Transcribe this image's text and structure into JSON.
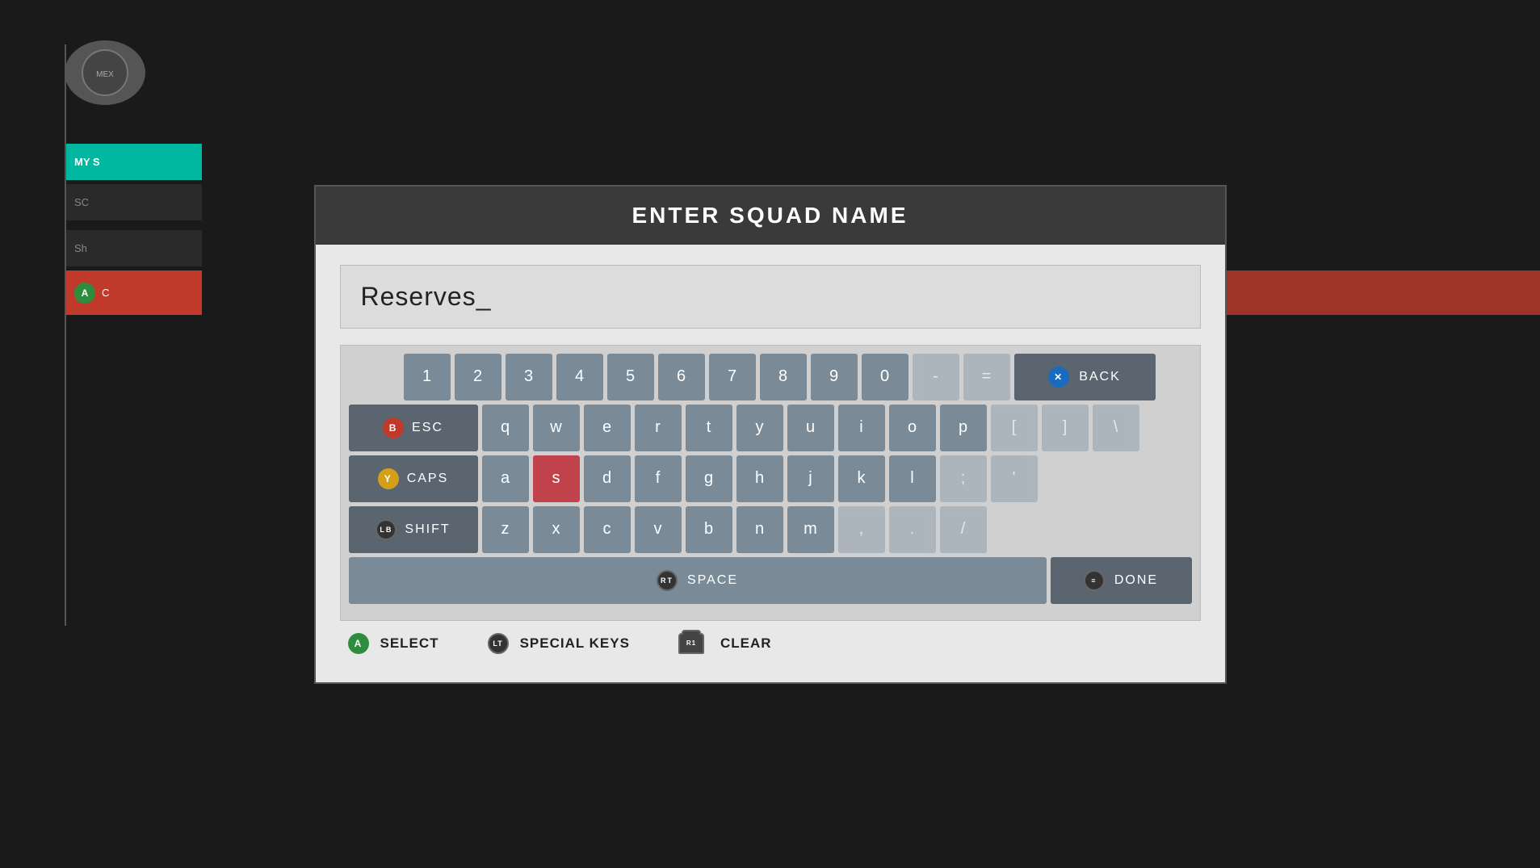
{
  "modal": {
    "title": "ENTER SQUAD NAME",
    "input_value": "Reserves_"
  },
  "keyboard": {
    "row_numbers": [
      "1",
      "2",
      "3",
      "4",
      "5",
      "6",
      "7",
      "8",
      "9",
      "0",
      "-",
      "="
    ],
    "row_qwerty": [
      "q",
      "w",
      "e",
      "r",
      "t",
      "y",
      "u",
      "i",
      "o",
      "p",
      "[",
      "]",
      "\\"
    ],
    "row_asdf": [
      "a",
      "s",
      "d",
      "f",
      "g",
      "h",
      "j",
      "k",
      "l",
      ";",
      "'"
    ],
    "row_zxcv": [
      "z",
      "x",
      "c",
      "v",
      "b",
      "n",
      "m",
      ",",
      ".",
      "/"
    ],
    "esc_label": "ESC",
    "caps_label": "CAPS",
    "shift_label": "SHIFT",
    "space_label": "SPACE",
    "back_label": "BACK",
    "done_label": "DONE",
    "active_key": "s"
  },
  "actions": {
    "select_label": "SELECT",
    "special_keys_label": "SPECIAL KEYS",
    "clear_label": "CLEAR"
  },
  "background": {
    "my_squads": "MY S...",
    "squad": "SC..."
  }
}
